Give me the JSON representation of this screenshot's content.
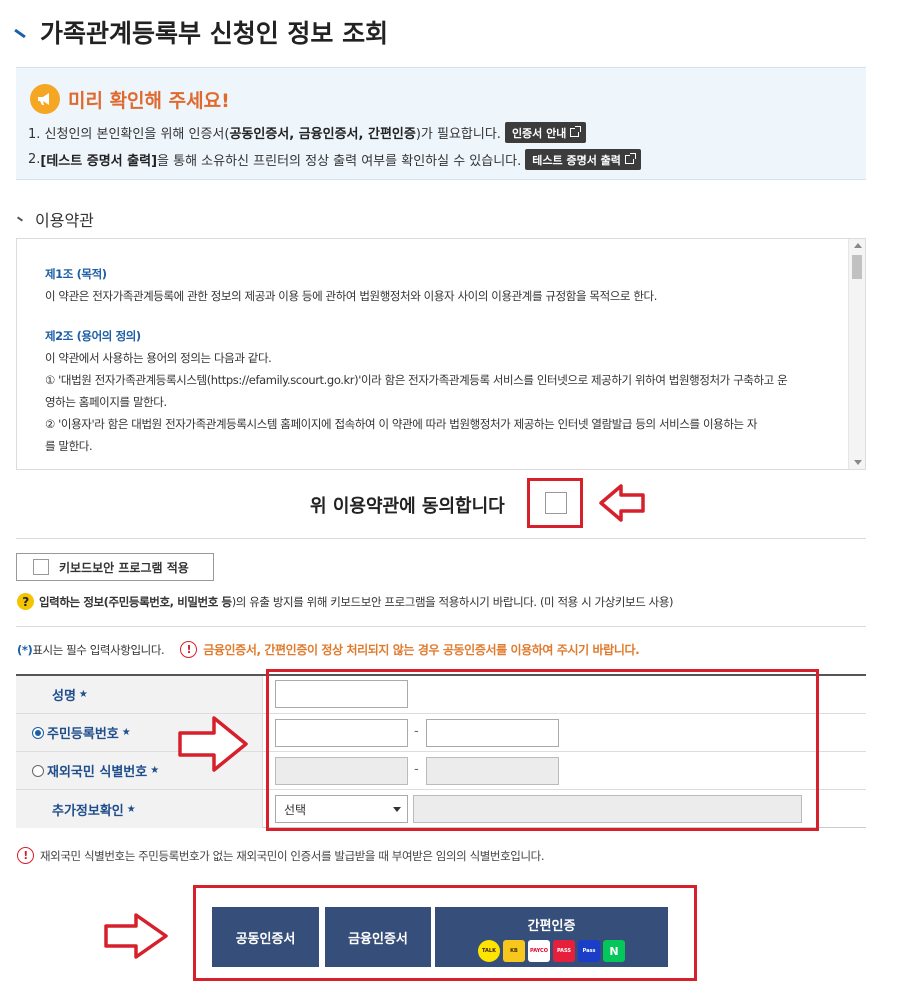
{
  "page": {
    "title": "가족관계등록부 신청인 정보 조회"
  },
  "notice": {
    "title": "미리 확인해 주세요!",
    "line1_before": "1. 신청인의 본인확인을 위해 인증서(",
    "line1_bold": "공동인증서, 금융인증서, 간편인증",
    "line1_after": ")가 필요합니다.",
    "cert_guide_button": "인증서 안내",
    "line2_before": "2. ",
    "line2_bold": "[테스트 증명서 출력]",
    "line2_after": "을 통해 소유하신 프린터의 정상 출력 여부를 확인하실 수 있습니다.",
    "test_print_button": "테스트 증명서 출력"
  },
  "terms": {
    "section_title": "이용약관",
    "article1_title": "제1조 (목적)",
    "article1_text": "이 약관은 전자가족관계등록에 관한 정보의 제공과 이용 등에 관하여 법원행정처와 이용자 사이의 이용관계를 규정함을 목적으로 한다.",
    "article2_title": "제2조 (용어의 정의)",
    "article2_intro": "이 약관에서 사용하는 용어의 정의는 다음과 같다.",
    "article2_item1a": "① '대법원 전자가족관계등록시스템(https://efamily.scourt.go.kr)'이라 함은 전자가족관계등록 서비스를 인터넷으로 제공하기 위하여 법원행정처가 구축하고 운",
    "article2_item1b": "영하는 홈페이지를 말한다.",
    "article2_item2a": "② '이용자'라 함은 대법원 전자가족관계등록시스템 홈페이지에 접속하여 이 약관에 따라 법원행정처가 제공하는 인터넷 열람발급 등의 서비스를 이용하는 자",
    "article2_item2b": "를 말한다.",
    "agree_label": "위 이용약관에 동의합니다"
  },
  "keyboard": {
    "button_label": "키보드보안 프로그램 적용",
    "info_before": "입력하는 정보(",
    "info_bold": "주민등록번호, 비밀번호 등",
    "info_after": ")의 유출 방지를 위해 키보드보안 프로그램을 적용하시기 바랍니다. (미 적용 시 가상키보드 사용)"
  },
  "form": {
    "required_star": "(*)",
    "required_note": " 표시는 필수 입력사항입니다.",
    "warning": "금융인증서, 간편인증이 정상 처리되지 않는 경우 공동인증서를 이용하여 주시기 바랍니다.",
    "name_label": "성명",
    "rrn_label": "주민등록번호",
    "foreign_label": "재외국민 식별번호",
    "extra_label": "추가정보확인",
    "star": "★",
    "dash": "-",
    "select_value": "선택",
    "foreign_note": "재외국민 식별번호는 주민등록번호가 없는 재외국민이 인증서를 발급받을 때 부여받은 임의의 식별번호입니다."
  },
  "buttons": {
    "public_cert": "공동인증서",
    "financial_cert": "금융인증서",
    "simple_cert": "간편인증",
    "simple_icons": [
      "TALK",
      "KB",
      "PAYCO",
      "PASS",
      "Pass",
      "N"
    ]
  },
  "colors": {
    "accent_blue": "#1a5fa8",
    "button_navy": "#364f7a",
    "annotation_red": "#d6202b",
    "notice_orange": "#e06a2e"
  }
}
